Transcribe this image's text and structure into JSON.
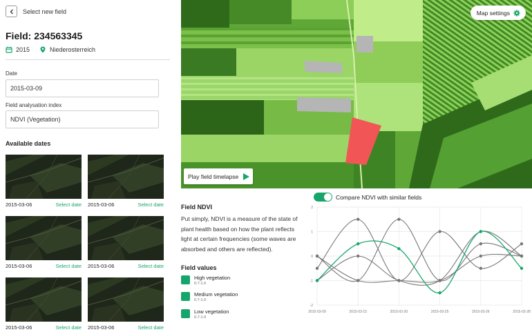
{
  "header": {
    "back_label": "Select new field"
  },
  "field": {
    "title": "Field: 234563345",
    "year": "2015",
    "region": "Niederosterreich"
  },
  "form": {
    "date_label": "Date",
    "date_value": "2015-03-09",
    "index_label": "Field analysation index",
    "index_value": "NDVI (Vegetation)"
  },
  "available": {
    "title": "Available dates",
    "items": [
      {
        "date": "2015-03-06",
        "action": "Select date"
      },
      {
        "date": "2015-03-06",
        "action": "Select date"
      },
      {
        "date": "2015-03-06",
        "action": "Select date"
      },
      {
        "date": "2015-03-06",
        "action": "Select date"
      },
      {
        "date": "2015-03-06",
        "action": "Select date"
      },
      {
        "date": "2015-03-06",
        "action": "Select date"
      }
    ]
  },
  "map": {
    "settings_label": "Map settings",
    "timelapse_label": "Play field timelapse"
  },
  "info": {
    "title": "Field NDVI",
    "text": "Put simply, NDVI is a measure of the state of plant health based on how the plant reflects light at certain frequencies (some waves are absorbed and others are reflected).",
    "values_title": "Field values",
    "legend": [
      {
        "name": "High vegetation",
        "range": "0.7-1.0"
      },
      {
        "name": "Medium vegetation",
        "range": "0.7-1.0"
      },
      {
        "name": "Low vegetation",
        "range": "0.7-1.0"
      }
    ]
  },
  "compare": {
    "label": "Compare NDVI with similar fields",
    "enabled": true
  },
  "chart_data": {
    "type": "line",
    "x": [
      "2015-03-09",
      "2015-03-15",
      "2015-03-20",
      "2015-03-25",
      "2015-03-26",
      "2015-03-28"
    ],
    "ylim": [
      -2,
      2
    ],
    "yticks": [
      2,
      1,
      0,
      -1,
      -2
    ],
    "grid": true,
    "series": [
      {
        "values": [
          -1,
          0.5,
          0.3,
          -1.5,
          1,
          -0.5
        ],
        "color": "#17a56b"
      },
      {
        "values": [
          -0.5,
          1.5,
          -1,
          1,
          -0.5,
          0.5
        ],
        "color": "#777777"
      },
      {
        "values": [
          0,
          -1,
          1.5,
          -1,
          0.5,
          0
        ],
        "color": "#777777"
      },
      {
        "values": [
          -1,
          0,
          -1,
          -1,
          1,
          0
        ],
        "color": "#777777"
      },
      {
        "values": [
          0,
          -1,
          -1,
          -1,
          0,
          0
        ],
        "color": "#777777"
      }
    ]
  }
}
